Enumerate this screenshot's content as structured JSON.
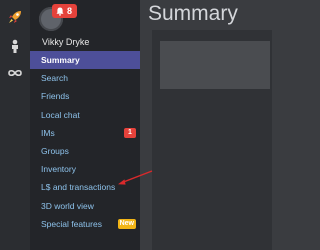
{
  "rail": {
    "items": [
      {
        "icon": "rocket-icon"
      },
      {
        "icon": "person-icon"
      },
      {
        "icon": "infinity-icon"
      }
    ]
  },
  "user": {
    "name": "Vikky Dryke",
    "notification_count": "8"
  },
  "sidebar": {
    "items": [
      {
        "label": "Summary",
        "active": true
      },
      {
        "label": "Search"
      },
      {
        "label": "Friends"
      },
      {
        "label": "Local chat"
      },
      {
        "label": "IMs",
        "badge": "1"
      },
      {
        "label": "Groups"
      },
      {
        "label": "Inventory"
      },
      {
        "label": "L$ and transactions"
      },
      {
        "label": "3D world view"
      },
      {
        "label": "Special features",
        "badge": "New"
      }
    ]
  },
  "main": {
    "title": "Summary"
  },
  "colors": {
    "accent": "#4d4f99",
    "link": "#8ec3ec",
    "badge_red": "#e5423b",
    "badge_yellow": "#f2b516",
    "annotation_arrow": "#d9292b"
  }
}
